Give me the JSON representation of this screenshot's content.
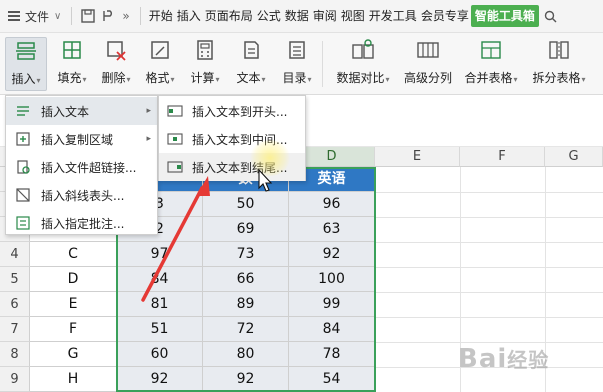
{
  "menubar": {
    "file_label": "文件",
    "tabs": [
      {
        "label": "开始",
        "active": false
      },
      {
        "label": "插入",
        "active": false
      },
      {
        "label": "页面布局",
        "active": false
      },
      {
        "label": "公式",
        "active": false
      },
      {
        "label": "数据",
        "active": false
      },
      {
        "label": "审阅",
        "active": false
      },
      {
        "label": "视图",
        "active": false
      },
      {
        "label": "开发工具",
        "active": false
      },
      {
        "label": "会员专享",
        "active": false
      },
      {
        "label": "智能工具箱",
        "active": true
      }
    ],
    "accent_color": "#4caf50"
  },
  "ribbon": {
    "buttons": [
      {
        "label": "插入",
        "icon": "insert-rows-icon",
        "pressed": true
      },
      {
        "label": "填充",
        "icon": "fill-icon",
        "pressed": false
      },
      {
        "label": "删除",
        "icon": "delete-icon",
        "pressed": false
      },
      {
        "label": "格式",
        "icon": "format-icon",
        "pressed": false
      },
      {
        "label": "计算",
        "icon": "calculate-icon",
        "pressed": false
      },
      {
        "label": "文本",
        "icon": "text-icon",
        "pressed": false
      },
      {
        "label": "目录",
        "icon": "catalog-icon",
        "pressed": false
      },
      {
        "label": "数据对比",
        "icon": "data-compare-icon",
        "pressed": false
      },
      {
        "label": "高级分列",
        "icon": "advanced-split-icon",
        "pressed": false
      },
      {
        "label": "合并表格",
        "icon": "merge-table-icon",
        "pressed": false
      },
      {
        "label": "拆分表格",
        "icon": "split-table-icon",
        "pressed": false
      }
    ]
  },
  "insert_menu": {
    "items": [
      {
        "label": "插入文本",
        "icon": "insert-text-icon",
        "has_submenu": true,
        "highlighted": true
      },
      {
        "label": "插入复制区域",
        "icon": "insert-copy-area-icon",
        "has_submenu": true,
        "highlighted": false
      },
      {
        "label": "插入文件超链接...",
        "icon": "insert-hyperlink-icon",
        "has_submenu": false,
        "highlighted": false
      },
      {
        "label": "插入斜线表头...",
        "icon": "insert-diagonal-header-icon",
        "has_submenu": false,
        "highlighted": false
      },
      {
        "label": "插入指定批注...",
        "icon": "insert-comment-icon",
        "has_submenu": false,
        "highlighted": false
      }
    ]
  },
  "text_submenu": {
    "items": [
      {
        "label": "插入文本到开头...",
        "icon": "insert-at-start-icon"
      },
      {
        "label": "插入文本到中间...",
        "icon": "insert-at-middle-icon"
      },
      {
        "label": "插入文本到结尾...",
        "icon": "insert-at-end-icon"
      }
    ]
  },
  "sheet": {
    "columns": [
      "D",
      "E",
      "F",
      "G"
    ],
    "selected_columns": [
      "D"
    ],
    "header_row": {
      "d": "英语",
      "c_partial": "数"
    },
    "rows": [
      {
        "num": "",
        "a": "",
        "b": "3",
        "c": "50",
        "d": "96"
      },
      {
        "num": "",
        "a": "",
        "b": "2",
        "c": "69",
        "d": "63"
      },
      {
        "num": "4",
        "a": "C",
        "b": "97",
        "c": "73",
        "d": "92"
      },
      {
        "num": "5",
        "a": "D",
        "b": "84",
        "c": "66",
        "d": "100"
      },
      {
        "num": "6",
        "a": "E",
        "b": "81",
        "b_full": "81",
        "c": "89",
        "d": "99"
      },
      {
        "num": "7",
        "a": "F",
        "b": "51",
        "c": "72",
        "d": "84"
      },
      {
        "num": "8",
        "a": "G",
        "b": "60",
        "c": "80",
        "d": "78"
      },
      {
        "num": "9",
        "a": "H",
        "b": "92",
        "c": "92",
        "d": "54"
      }
    ],
    "header_color": "#2f78c4",
    "selection_color": "#3aa05a"
  },
  "annotation": {
    "arrow_color": "#e53935"
  },
  "watermark": {
    "text_main": "Bai",
    "text_tail": "经验"
  }
}
